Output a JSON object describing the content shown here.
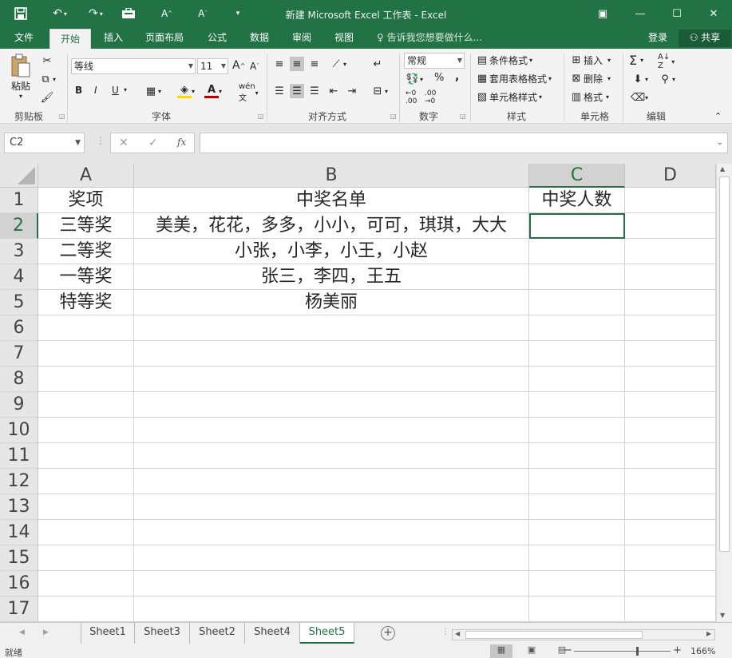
{
  "window": {
    "title": "新建 Microsoft Excel 工作表 - Excel",
    "quick_access": {
      "save_icon": "save-icon",
      "undo_icon": "undo-icon",
      "redo_icon": "redo-icon"
    },
    "controls": {
      "ribbon_display": "▣",
      "minimize": "—",
      "maximize": "☐",
      "close": "✕"
    }
  },
  "ribbon_tabs": {
    "file": "文件",
    "home": "开始",
    "insert": "插入",
    "page_layout": "页面布局",
    "formulas": "公式",
    "data": "数据",
    "review": "审阅",
    "view": "视图",
    "tell_me": "告诉我您想要做什么...",
    "login": "登录",
    "share": "共享"
  },
  "ribbon": {
    "clipboard": {
      "label": "剪贴板",
      "paste": "粘贴"
    },
    "font": {
      "label": "字体",
      "font_name": "等线",
      "font_size": "11",
      "bold": "B",
      "italic": "I",
      "underline": "U"
    },
    "alignment": {
      "label": "对齐方式"
    },
    "number": {
      "label": "数字",
      "format": "常规",
      "percent": "%",
      "comma": ","
    },
    "styles": {
      "label": "样式",
      "conditional": "条件格式",
      "table": "套用表格格式",
      "cell_styles": "单元格样式"
    },
    "cells": {
      "label": "单元格",
      "insert": "插入",
      "delete": "删除",
      "format": "格式"
    },
    "editing": {
      "label": "编辑"
    }
  },
  "formula_bar": {
    "name_box": "C2",
    "cancel": "✕",
    "enter": "✓",
    "fx": "fx",
    "formula": ""
  },
  "sheet": {
    "columns": [
      "A",
      "B",
      "C",
      "D"
    ],
    "selected_column": "C",
    "selected_row": "2",
    "rows": [
      {
        "num": "1",
        "A": "奖项",
        "B": "中奖名单",
        "C": "中奖人数",
        "D": ""
      },
      {
        "num": "2",
        "A": "三等奖",
        "B": "美美，花花，多多，小小，可可，琪琪，大大",
        "C": "",
        "D": ""
      },
      {
        "num": "3",
        "A": "二等奖",
        "B": "小张，小李，小王，小赵",
        "C": "",
        "D": ""
      },
      {
        "num": "4",
        "A": "一等奖",
        "B": "张三，李四，王五",
        "C": "",
        "D": ""
      },
      {
        "num": "5",
        "A": "特等奖",
        "B": "杨美丽",
        "C": "",
        "D": ""
      },
      {
        "num": "6",
        "A": "",
        "B": "",
        "C": "",
        "D": ""
      },
      {
        "num": "7",
        "A": "",
        "B": "",
        "C": "",
        "D": ""
      },
      {
        "num": "8",
        "A": "",
        "B": "",
        "C": "",
        "D": ""
      },
      {
        "num": "9",
        "A": "",
        "B": "",
        "C": "",
        "D": ""
      },
      {
        "num": "10",
        "A": "",
        "B": "",
        "C": "",
        "D": ""
      },
      {
        "num": "11",
        "A": "",
        "B": "",
        "C": "",
        "D": ""
      },
      {
        "num": "12",
        "A": "",
        "B": "",
        "C": "",
        "D": ""
      },
      {
        "num": "13",
        "A": "",
        "B": "",
        "C": "",
        "D": ""
      },
      {
        "num": "14",
        "A": "",
        "B": "",
        "C": "",
        "D": ""
      },
      {
        "num": "15",
        "A": "",
        "B": "",
        "C": "",
        "D": ""
      },
      {
        "num": "16",
        "A": "",
        "B": "",
        "C": "",
        "D": ""
      },
      {
        "num": "17",
        "A": "",
        "B": "",
        "C": "",
        "D": ""
      }
    ]
  },
  "sheet_tabs": [
    "Sheet1",
    "Sheet3",
    "Sheet2",
    "Sheet4",
    "Sheet5"
  ],
  "active_sheet": "Sheet5",
  "status": {
    "ready": "就绪",
    "zoom": "166%"
  },
  "colors": {
    "accent": "#217346",
    "ribbon_bg": "#f3f3f3",
    "grid_line": "#d4d4d4"
  }
}
